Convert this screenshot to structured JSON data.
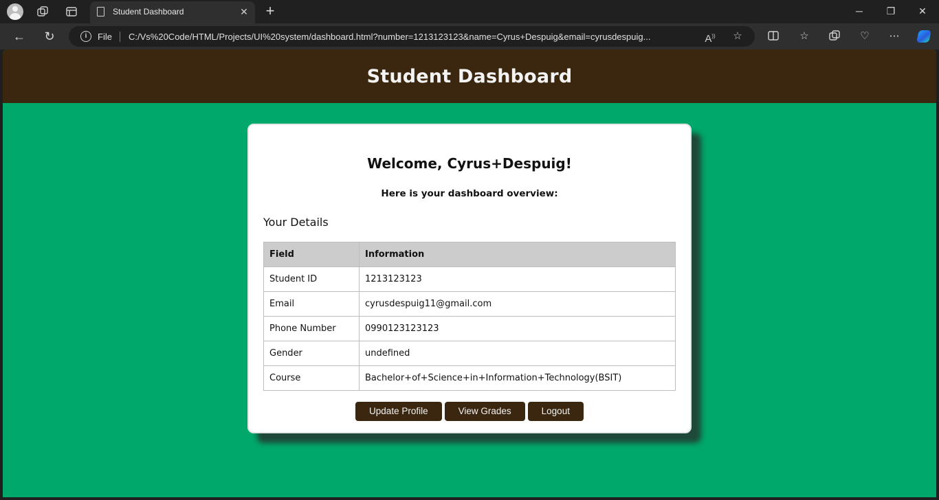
{
  "browser": {
    "tab_title": "Student Dashboard",
    "new_tab_symbol": "+",
    "url_scheme_label": "File",
    "url": "C:/Vs%20Code/HTML/Projects/UI%20system/dashboard.html?number=1213123123&name=Cyrus+Despuig&email=cyrusdespuig..."
  },
  "page": {
    "header_title": "Student Dashboard",
    "welcome": "Welcome, Cyrus+Despuig!",
    "overview": "Here is your dashboard overview:",
    "details_title": "Your Details",
    "table": {
      "headers": [
        "Field",
        "Information"
      ],
      "rows": [
        [
          "Student ID",
          "1213123123"
        ],
        [
          "Email",
          "cyrusdespuig11@gmail.com"
        ],
        [
          "Phone Number",
          "0990123123123"
        ],
        [
          "Gender",
          "undefined"
        ],
        [
          "Course",
          "Bachelor+of+Science+in+Information+Technology(BSIT)"
        ]
      ]
    },
    "buttons": {
      "update": "Update Profile",
      "grades": "View Grades",
      "logout": "Logout"
    }
  },
  "colors": {
    "header_brown": "#3b2710",
    "page_green": "#00a86b",
    "table_header_gray": "#cccccc"
  }
}
